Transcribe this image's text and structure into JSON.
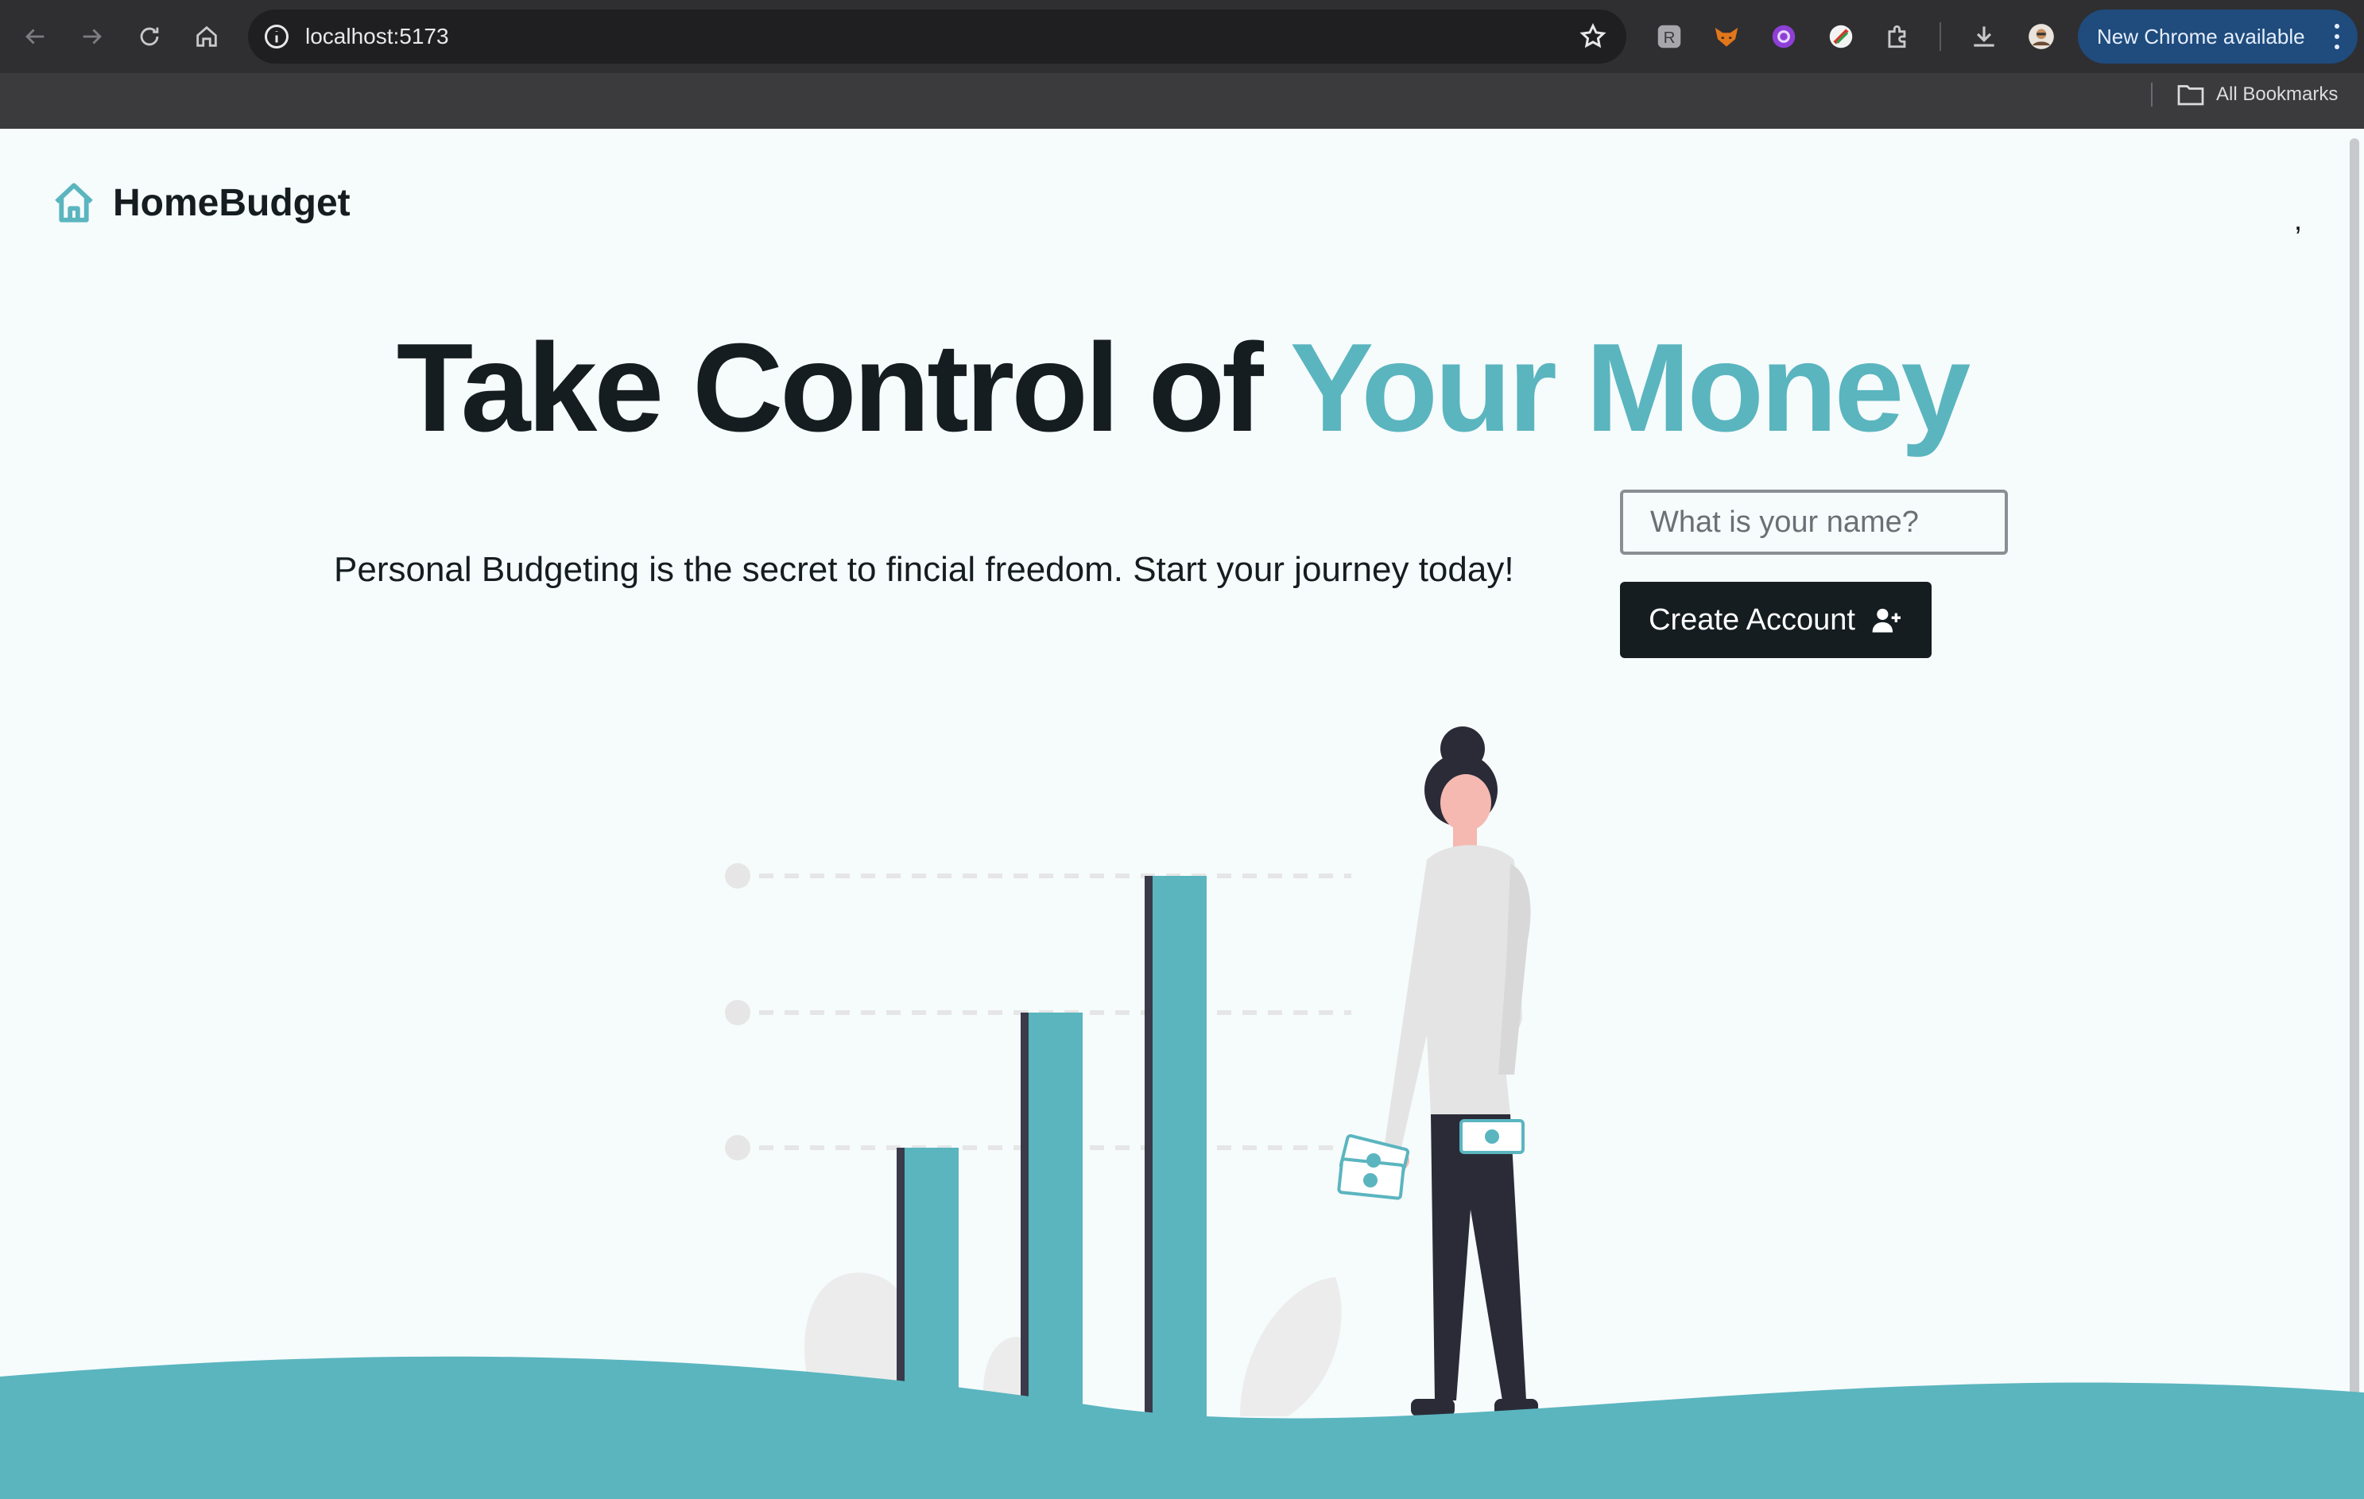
{
  "browser": {
    "url": "localhost:5173",
    "update_pill": "New Chrome available",
    "bookmarks_folder": "All Bookmarks"
  },
  "app": {
    "brand": "HomeBudget",
    "stray_char": ",",
    "hero": {
      "title_main": "Take Control of",
      "title_accent": "Your Money"
    },
    "tagline": "Personal Budgeting is the secret to fincial freedom. Start your journey today!",
    "form": {
      "name_placeholder": "What is your name?",
      "name_value": "",
      "submit_label": "Create Account"
    }
  },
  "colors": {
    "accent": "#5ab5bf",
    "text_dark": "#151d20",
    "background": "#f6fbfc",
    "chrome_dark": "#2f2f31",
    "update_pill": "#1f4b7d"
  },
  "icons": {
    "logo": "house-icon",
    "submit": "user-plus-icon",
    "url_info": "info-circle-icon",
    "bookmark": "star-icon",
    "bookmarks_folder": "folder-icon"
  }
}
